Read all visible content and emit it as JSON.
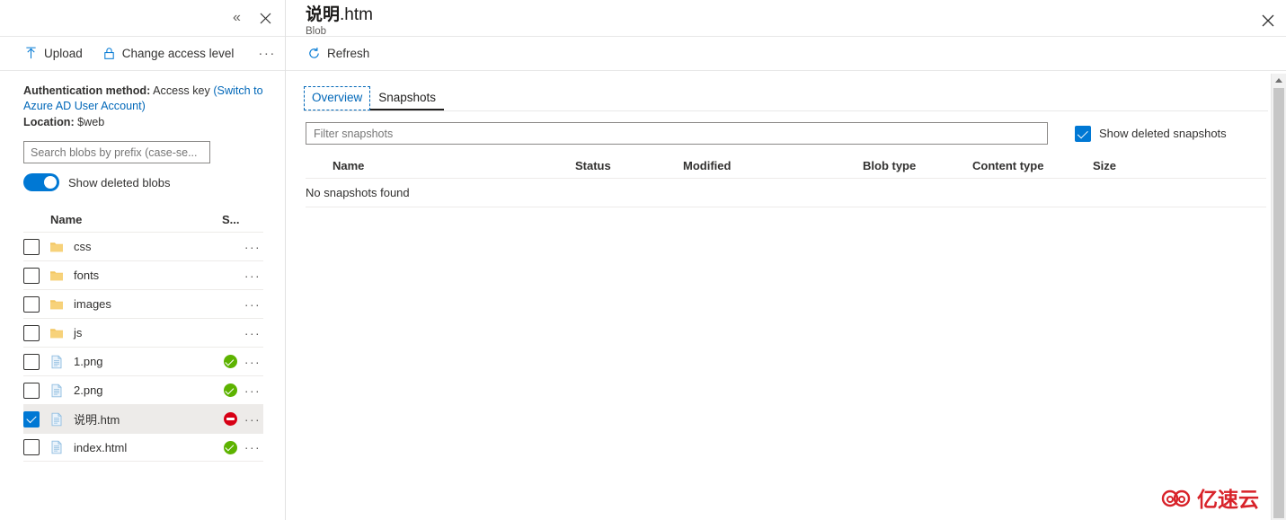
{
  "left_panel": {
    "titlebar": {
      "collapse_icon": "chevron-double-left-icon",
      "close_icon": "close-icon"
    },
    "toolbar": {
      "upload_label": "Upload",
      "upload_icon": "upload-arrow-icon",
      "change_access_label": "Change access level",
      "change_access_icon": "lock-icon",
      "more_label": "···"
    },
    "auth": {
      "method_label": "Authentication method:",
      "method_value": "Access key",
      "switch_link": "(Switch to Azure AD User Account)",
      "location_label": "Location:",
      "location_value": "$web"
    },
    "search": {
      "placeholder": "Search blobs by prefix (case-se...",
      "value": ""
    },
    "show_deleted_blobs": {
      "label": "Show deleted blobs",
      "on": true
    },
    "table": {
      "columns": [
        "Name",
        "S..."
      ],
      "rows": [
        {
          "name": "css",
          "kind": "folder",
          "status": "",
          "checked": false,
          "selected": false,
          "more": "···"
        },
        {
          "name": "fonts",
          "kind": "folder",
          "status": "",
          "checked": false,
          "selected": false,
          "more": "···"
        },
        {
          "name": "images",
          "kind": "folder",
          "status": "",
          "checked": false,
          "selected": false,
          "more": "···"
        },
        {
          "name": "js",
          "kind": "folder",
          "status": "",
          "checked": false,
          "selected": false,
          "more": "···"
        },
        {
          "name": "1.png",
          "kind": "file",
          "status": "active",
          "checked": false,
          "selected": false,
          "more": "···"
        },
        {
          "name": "2.png",
          "kind": "file",
          "status": "active",
          "checked": false,
          "selected": false,
          "more": "···"
        },
        {
          "name": "说明.htm",
          "kind": "file",
          "status": "deleted",
          "checked": true,
          "selected": true,
          "more": "···"
        },
        {
          "name": "index.html",
          "kind": "file",
          "status": "active",
          "checked": false,
          "selected": false,
          "more": "···"
        }
      ]
    }
  },
  "right_panel": {
    "title": "说明",
    "title_ext": ".htm",
    "subtitle": "Blob",
    "close_icon": "close-icon",
    "toolbar": {
      "refresh_label": "Refresh",
      "refresh_icon": "refresh-icon"
    },
    "tabs": [
      {
        "label": "Overview",
        "active": false,
        "focused": true
      },
      {
        "label": "Snapshots",
        "active": true,
        "focused": false
      }
    ],
    "filter": {
      "placeholder": "Filter snapshots",
      "value": ""
    },
    "show_deleted_snapshots": {
      "label": "Show deleted snapshots",
      "checked": true
    },
    "snapshots_table": {
      "columns": [
        "Name",
        "Status",
        "Modified",
        "Blob type",
        "Content type",
        "Size"
      ],
      "empty_message": "No snapshots found",
      "rows": []
    },
    "scrollbar": {
      "up_arrow_icon": "scroll-up-arrow-icon"
    }
  },
  "watermark": {
    "text": "亿速云",
    "icon": "cloud-logo-icon",
    "color": "#d8232a"
  },
  "colors": {
    "accent": "#0078d4",
    "link": "#0067b8",
    "status_ok": "#5db300",
    "status_deleted": "#d70015",
    "selected_row": "#edebe9"
  }
}
